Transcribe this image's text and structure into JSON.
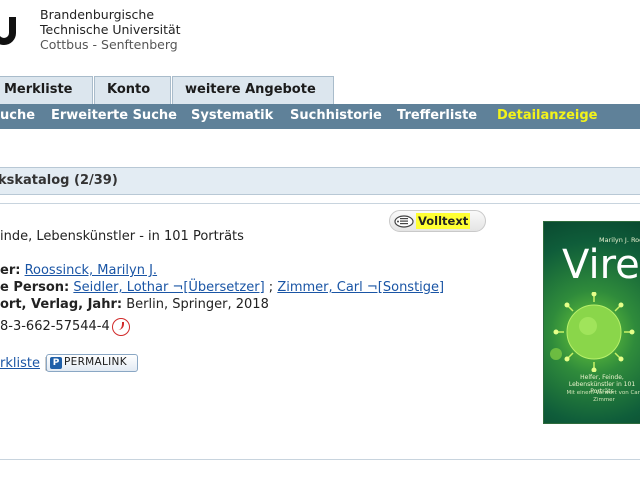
{
  "header": {
    "university_line1": "Brandenburgische",
    "university_line2": "Technische Universität",
    "university_line3": "Cottbus - Senftenberg"
  },
  "tabs": [
    "Merkliste",
    "Konto",
    "weitere Angebote"
  ],
  "subnav": [
    "uche",
    "Erweiterte Suche",
    "Systematik",
    "Suchhistorie",
    "Trefferliste",
    "Detailanzeige"
  ],
  "subnav_active": "Detailanzeige",
  "result": {
    "header": "kskatalog (2/39)",
    "title_fragment": "inde, Lebenskünstler - in 101 Porträts",
    "author_label": "er:",
    "author": "Roossinck, Marilyn J.",
    "person_label": "e Person:",
    "person1": "Seidler, Lothar ¬[Übersetzer]",
    "separator": ";",
    "person2": "Zimmer, Carl ¬[Sonstige]",
    "publisher_label": "ort, Verlag, Jahr:",
    "publisher": "Berlin, Springer, 2018",
    "isbn": "8-3-662-57544-4",
    "merkliste_link": "rkliste",
    "pipe": "|",
    "permalink": "PERMALINK",
    "volltext": "Volltext"
  },
  "cover": {
    "author": "Marilyn J. Roossinck",
    "title": "Viren",
    "subtitle": "Helfer, Feinde, Lebenskünstler in 101 Porträts",
    "foreword": "Mit einem Vorwort von Carl Zimmer"
  },
  "colors": {
    "subnav_bg": "#5f8199",
    "active_link": "#f3f31a",
    "link": "#1a55a5",
    "highlight": "#ffff33"
  }
}
